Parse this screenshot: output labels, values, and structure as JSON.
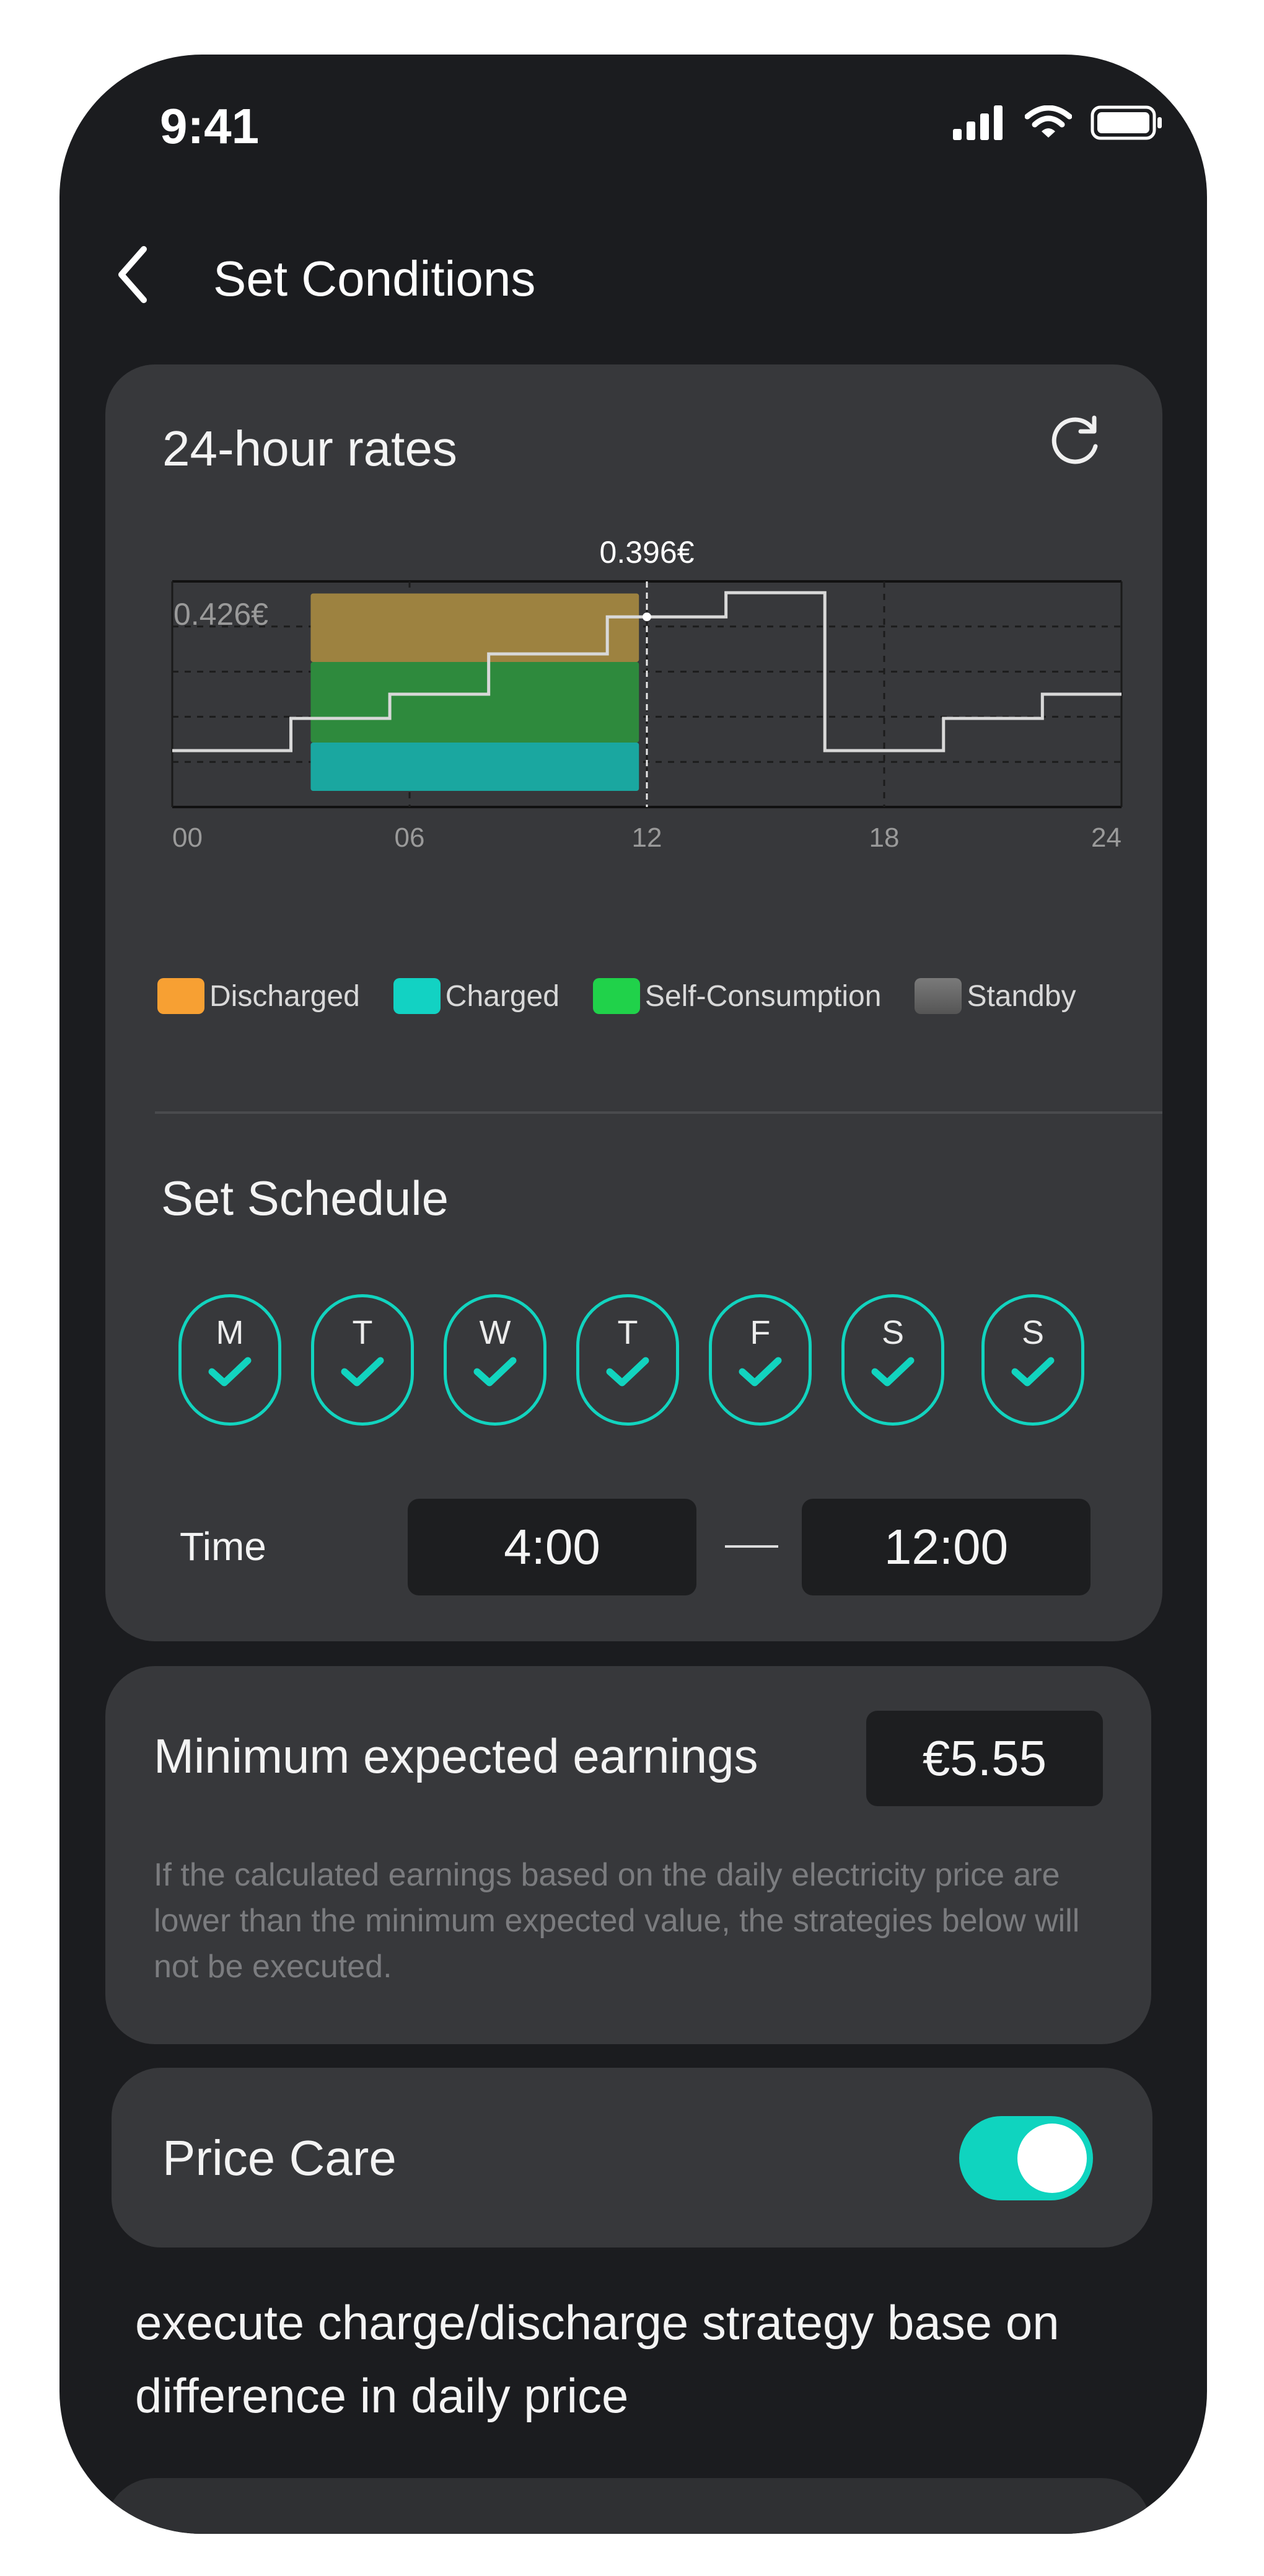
{
  "status_bar": {
    "time": "9:41"
  },
  "header": {
    "title": "Set Conditions"
  },
  "rates": {
    "title": "24-hour rates",
    "selected_value_label": "0.396€",
    "max_label": "0.426€"
  },
  "chart_data": {
    "type": "line",
    "x_tick_labels": [
      "00",
      "06",
      "12",
      "18",
      "24"
    ],
    "xlim": [
      0,
      24
    ],
    "ylim": [
      0.16,
      0.44
    ],
    "series": [
      {
        "values": [
          {
            "x": 0,
            "y": 0.23
          },
          {
            "x": 3,
            "y": 0.23
          },
          {
            "x": 3,
            "y": 0.27
          },
          {
            "x": 5.5,
            "y": 0.27
          },
          {
            "x": 5.5,
            "y": 0.3
          },
          {
            "x": 8,
            "y": 0.3
          },
          {
            "x": 8,
            "y": 0.35
          },
          {
            "x": 11,
            "y": 0.35
          },
          {
            "x": 11,
            "y": 0.396
          },
          {
            "x": 14,
            "y": 0.396
          },
          {
            "x": 14,
            "y": 0.426
          },
          {
            "x": 16.5,
            "y": 0.426
          },
          {
            "x": 16.5,
            "y": 0.23
          },
          {
            "x": 19.5,
            "y": 0.23
          },
          {
            "x": 19.5,
            "y": 0.27
          },
          {
            "x": 22,
            "y": 0.27
          },
          {
            "x": 22,
            "y": 0.3
          },
          {
            "x": 24,
            "y": 0.3
          }
        ]
      }
    ],
    "bands": [
      {
        "legend": "Charged",
        "x_range": [
          3.5,
          11.8
        ],
        "y_range": [
          0.18,
          0.24
        ],
        "color": "#1aa7a0"
      },
      {
        "legend": "Self-Consumption",
        "x_range": [
          3.5,
          11.8
        ],
        "y_range": [
          0.24,
          0.34
        ],
        "color": "#2e8a3d"
      },
      {
        "legend": "Discharged",
        "x_range": [
          3.5,
          11.8
        ],
        "y_range": [
          0.34,
          0.425
        ],
        "color": "#9d8240"
      }
    ],
    "cursor": {
      "x": 12,
      "y": 0.396
    },
    "grid": true
  },
  "legend": [
    {
      "label": "Discharged",
      "color": "#f7a033"
    },
    {
      "label": "Charged",
      "color": "#12d2c3"
    },
    {
      "label": "Self-Consumption",
      "color": "#20d24a"
    },
    {
      "label": "Standby",
      "color": "#6b6b6b"
    }
  ],
  "schedule": {
    "title": "Set Schedule",
    "days": [
      {
        "letter": "M",
        "checked": true
      },
      {
        "letter": "T",
        "checked": true
      },
      {
        "letter": "W",
        "checked": true
      },
      {
        "letter": "T",
        "checked": true
      },
      {
        "letter": "F",
        "checked": true
      },
      {
        "letter": "S",
        "checked": true
      },
      {
        "letter": "S",
        "checked": true
      }
    ],
    "time_label": "Time",
    "start": "4:00",
    "end": "12:00"
  },
  "earnings": {
    "title": "Minimum expected earnings",
    "value": "€5.55",
    "note": "If the calculated earnings based on the daily electricity price are lower than the minimum expected value, the strategies below will not be executed."
  },
  "price_care": {
    "title": "Price Care",
    "enabled": true,
    "description": "execute charge/discharge strategy base on difference in daily price"
  },
  "colors": {
    "accent": "#12d4bf",
    "background": "#1b1c1f",
    "card": "#37383b"
  }
}
